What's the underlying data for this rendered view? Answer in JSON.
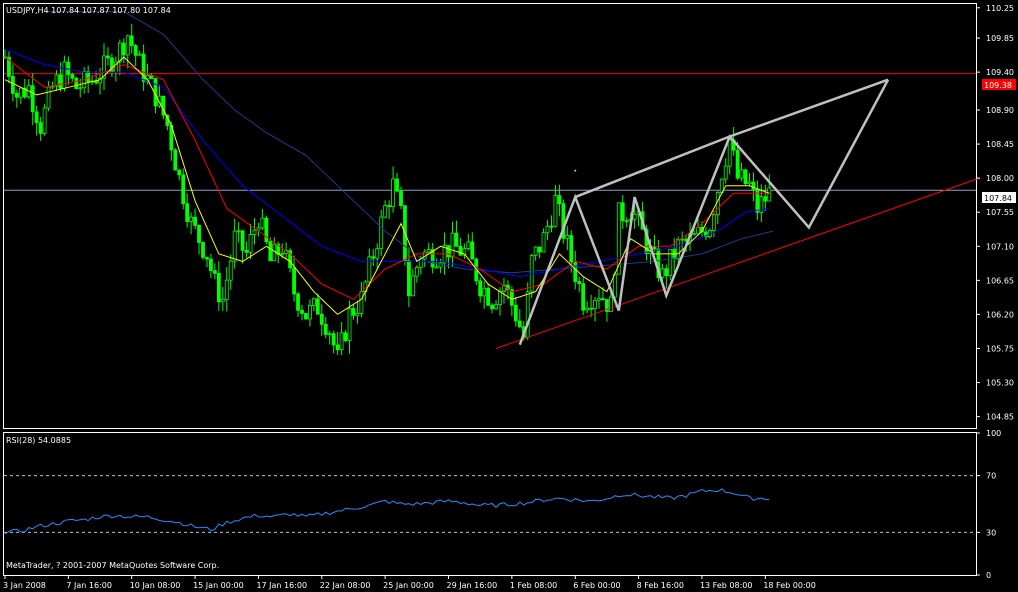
{
  "window": {
    "symbol_header": "USDJPY,H4  107.84 107.87 107.80 107.84",
    "copyright": "MetaTrader, ? 2001-2007 MetaQuotes Software Corp."
  },
  "colors": {
    "background": "#000000",
    "frame": "#ffffff",
    "candle": "#00ff00",
    "ma_fast": "#ffff00",
    "ma_mid": "#ff0000",
    "ma_slow": "#0000ff",
    "ma_long": "#1e3c8c",
    "resistance": "#ff0000",
    "trendline": "#ff0000",
    "pattern": "#c0c0c0",
    "rsi": "#1e90ff",
    "level_dash": "#c0c0c0"
  },
  "chart_data": [
    {
      "type": "candlestick",
      "title": "USDJPY,H4  107.84 107.87 107.80 107.84",
      "ylim": [
        104.7,
        110.3
      ],
      "y_ticks": [
        "110.25",
        "109.85",
        "109.40",
        "108.90",
        "108.45",
        "108.00",
        "107.55",
        "107.10",
        "106.65",
        "106.20",
        "105.75",
        "105.30",
        "104.85"
      ],
      "x_ticks": [
        "3 Jan 2008",
        "7 Jan 16:00",
        "10 Jan 08:00",
        "15 Jan 00:00",
        "17 Jan 16:00",
        "22 Jan 08:00",
        "25 Jan 00:00",
        "29 Jan 16:00",
        "1 Feb 08:00",
        "6 Feb 00:00",
        "8 Feb 16:00",
        "13 Feb 08:00",
        "18 Feb 00:00"
      ],
      "x_tick_bars": [
        0,
        16,
        32,
        48,
        64,
        80,
        96,
        112,
        128,
        144,
        160,
        176,
        192
      ],
      "current_price": "107.84",
      "current_price_value": 107.84,
      "resistance_label": "109.38",
      "resistance_value": 109.38,
      "close_anchors": [
        [
          0,
          109.6
        ],
        [
          3,
          109.1
        ],
        [
          6,
          109.2
        ],
        [
          9,
          108.7
        ],
        [
          12,
          109.2
        ],
        [
          15,
          109.4
        ],
        [
          18,
          109.2
        ],
        [
          22,
          109.3
        ],
        [
          26,
          109.5
        ],
        [
          29,
          109.7
        ],
        [
          31,
          109.9
        ],
        [
          34,
          109.5
        ],
        [
          38,
          109.1
        ],
        [
          41,
          108.7
        ],
        [
          44,
          108.0
        ],
        [
          47,
          107.4
        ],
        [
          51,
          107.0
        ],
        [
          53,
          106.6
        ],
        [
          55,
          106.4
        ],
        [
          58,
          107.2
        ],
        [
          61,
          107.0
        ],
        [
          64,
          107.5
        ],
        [
          67,
          106.9
        ],
        [
          70,
          107.1
        ],
        [
          73,
          106.5
        ],
        [
          76,
          106.2
        ],
        [
          79,
          106.3
        ],
        [
          82,
          106.0
        ],
        [
          84,
          105.6
        ],
        [
          87,
          106.2
        ],
        [
          90,
          106.4
        ],
        [
          93,
          107.0
        ],
        [
          96,
          107.6
        ],
        [
          98,
          107.9
        ],
        [
          100,
          107.5
        ],
        [
          102,
          106.5
        ],
        [
          105,
          107.0
        ],
        [
          109,
          107.0
        ],
        [
          113,
          107.1
        ],
        [
          117,
          107.0
        ],
        [
          120,
          106.6
        ],
        [
          123,
          106.4
        ],
        [
          126,
          106.6
        ],
        [
          129,
          106.2
        ],
        [
          131,
          105.9
        ],
        [
          133,
          106.9
        ],
        [
          136,
          107.2
        ],
        [
          139,
          107.7
        ],
        [
          142,
          107.1
        ],
        [
          146,
          106.4
        ],
        [
          150,
          106.5
        ],
        [
          153,
          106.3
        ],
        [
          155,
          107.5
        ],
        [
          158,
          107.6
        ],
        [
          160,
          107.4
        ],
        [
          163,
          107.0
        ],
        [
          166,
          106.7
        ],
        [
          170,
          107.1
        ],
        [
          174,
          107.2
        ],
        [
          178,
          107.4
        ],
        [
          181,
          108.1
        ],
        [
          183,
          108.5
        ],
        [
          185,
          108.0
        ],
        [
          188,
          107.9
        ],
        [
          190,
          107.6
        ],
        [
          193,
          107.8
        ]
      ],
      "ma_fast": [
        [
          0,
          109.3
        ],
        [
          8,
          109.1
        ],
        [
          16,
          109.2
        ],
        [
          24,
          109.3
        ],
        [
          30,
          109.6
        ],
        [
          36,
          109.3
        ],
        [
          42,
          108.7
        ],
        [
          48,
          107.7
        ],
        [
          54,
          107.0
        ],
        [
          60,
          106.9
        ],
        [
          66,
          107.1
        ],
        [
          72,
          106.9
        ],
        [
          78,
          106.5
        ],
        [
          84,
          106.2
        ],
        [
          90,
          106.4
        ],
        [
          96,
          107.0
        ],
        [
          100,
          107.4
        ],
        [
          104,
          106.9
        ],
        [
          110,
          107.1
        ],
        [
          116,
          107.0
        ],
        [
          122,
          106.6
        ],
        [
          128,
          106.4
        ],
        [
          134,
          106.5
        ],
        [
          140,
          107.0
        ],
        [
          146,
          106.7
        ],
        [
          152,
          106.5
        ],
        [
          158,
          107.2
        ],
        [
          164,
          107.0
        ],
        [
          170,
          107.0
        ],
        [
          176,
          107.3
        ],
        [
          182,
          107.9
        ],
        [
          188,
          107.9
        ],
        [
          193,
          107.8
        ]
      ],
      "ma_mid": [
        [
          0,
          109.6
        ],
        [
          10,
          109.2
        ],
        [
          20,
          109.3
        ],
        [
          30,
          109.5
        ],
        [
          40,
          109.3
        ],
        [
          48,
          108.5
        ],
        [
          56,
          107.6
        ],
        [
          64,
          107.3
        ],
        [
          72,
          107.0
        ],
        [
          80,
          106.6
        ],
        [
          88,
          106.4
        ],
        [
          96,
          106.8
        ],
        [
          104,
          107.0
        ],
        [
          112,
          107.0
        ],
        [
          120,
          106.8
        ],
        [
          128,
          106.5
        ],
        [
          136,
          106.6
        ],
        [
          144,
          106.9
        ],
        [
          152,
          106.8
        ],
        [
          160,
          107.1
        ],
        [
          168,
          107.1
        ],
        [
          176,
          107.4
        ],
        [
          184,
          107.8
        ],
        [
          188,
          107.8
        ],
        [
          193,
          107.8
        ]
      ],
      "ma_slow": [
        [
          0,
          109.7
        ],
        [
          10,
          109.5
        ],
        [
          20,
          109.4
        ],
        [
          30,
          109.4
        ],
        [
          40,
          109.2
        ],
        [
          50,
          108.5
        ],
        [
          60,
          107.9
        ],
        [
          70,
          107.5
        ],
        [
          80,
          107.1
        ],
        [
          90,
          106.9
        ],
        [
          100,
          106.9
        ],
        [
          110,
          106.9
        ],
        [
          120,
          106.8
        ],
        [
          130,
          106.7
        ],
        [
          140,
          106.8
        ],
        [
          150,
          106.9
        ],
        [
          160,
          107.0
        ],
        [
          170,
          107.1
        ],
        [
          180,
          107.3
        ],
        [
          187,
          107.55
        ],
        [
          193,
          107.6
        ]
      ],
      "ma_long": [
        [
          10,
          110.2
        ],
        [
          20,
          110.2
        ],
        [
          30,
          110.2
        ],
        [
          40,
          109.9
        ],
        [
          50,
          109.3
        ],
        [
          58,
          108.9
        ],
        [
          66,
          108.6
        ],
        [
          76,
          108.3
        ],
        [
          86,
          107.8
        ],
        [
          96,
          107.3
        ],
        [
          106,
          106.9
        ],
        [
          116,
          106.8
        ],
        [
          128,
          106.75
        ],
        [
          140,
          106.8
        ],
        [
          152,
          106.85
        ],
        [
          164,
          106.9
        ],
        [
          176,
          107.0
        ],
        [
          186,
          107.2
        ],
        [
          194,
          107.3
        ]
      ],
      "pattern_zigzag": [
        [
          130,
          105.8
        ],
        [
          144,
          107.75
        ],
        [
          155,
          106.25
        ],
        [
          159,
          107.75
        ],
        [
          167,
          106.45
        ],
        [
          183,
          108.55
        ],
        [
          203,
          107.35
        ],
        [
          223,
          109.3
        ]
      ],
      "pattern_upper": [
        [
          144,
          107.75
        ],
        [
          183,
          108.55
        ],
        [
          223,
          109.3
        ]
      ],
      "uptrend_line": [
        [
          124,
          105.75
        ],
        [
          246,
          108.0
        ]
      ],
      "marker_point": [
        144,
        108.1
      ]
    },
    {
      "type": "line",
      "title": "RSI(28) 54.0885",
      "ylim": [
        0,
        100
      ],
      "y_ticks": [
        "100",
        "70",
        "30",
        "0"
      ],
      "levels": [
        70,
        30
      ],
      "values_anchors": [
        [
          0,
          30
        ],
        [
          4,
          31
        ],
        [
          8,
          34
        ],
        [
          12,
          36
        ],
        [
          16,
          38
        ],
        [
          20,
          39
        ],
        [
          24,
          41
        ],
        [
          28,
          42
        ],
        [
          32,
          41
        ],
        [
          36,
          41
        ],
        [
          40,
          39
        ],
        [
          44,
          37
        ],
        [
          48,
          34
        ],
        [
          52,
          32
        ],
        [
          56,
          37
        ],
        [
          60,
          40
        ],
        [
          64,
          42
        ],
        [
          68,
          41
        ],
        [
          72,
          43
        ],
        [
          76,
          41
        ],
        [
          80,
          43
        ],
        [
          84,
          45
        ],
        [
          88,
          47
        ],
        [
          92,
          49
        ],
        [
          96,
          52
        ],
        [
          100,
          50
        ],
        [
          104,
          50
        ],
        [
          108,
          51
        ],
        [
          112,
          52
        ],
        [
          116,
          51
        ],
        [
          120,
          49
        ],
        [
          124,
          49
        ],
        [
          128,
          50
        ],
        [
          132,
          51
        ],
        [
          136,
          53
        ],
        [
          140,
          54
        ],
        [
          144,
          53
        ],
        [
          148,
          52
        ],
        [
          152,
          54
        ],
        [
          156,
          57
        ],
        [
          160,
          56
        ],
        [
          164,
          55
        ],
        [
          168,
          54
        ],
        [
          172,
          56
        ],
        [
          176,
          59
        ],
        [
          180,
          60
        ],
        [
          184,
          58
        ],
        [
          188,
          54
        ],
        [
          193,
          54
        ]
      ]
    }
  ]
}
